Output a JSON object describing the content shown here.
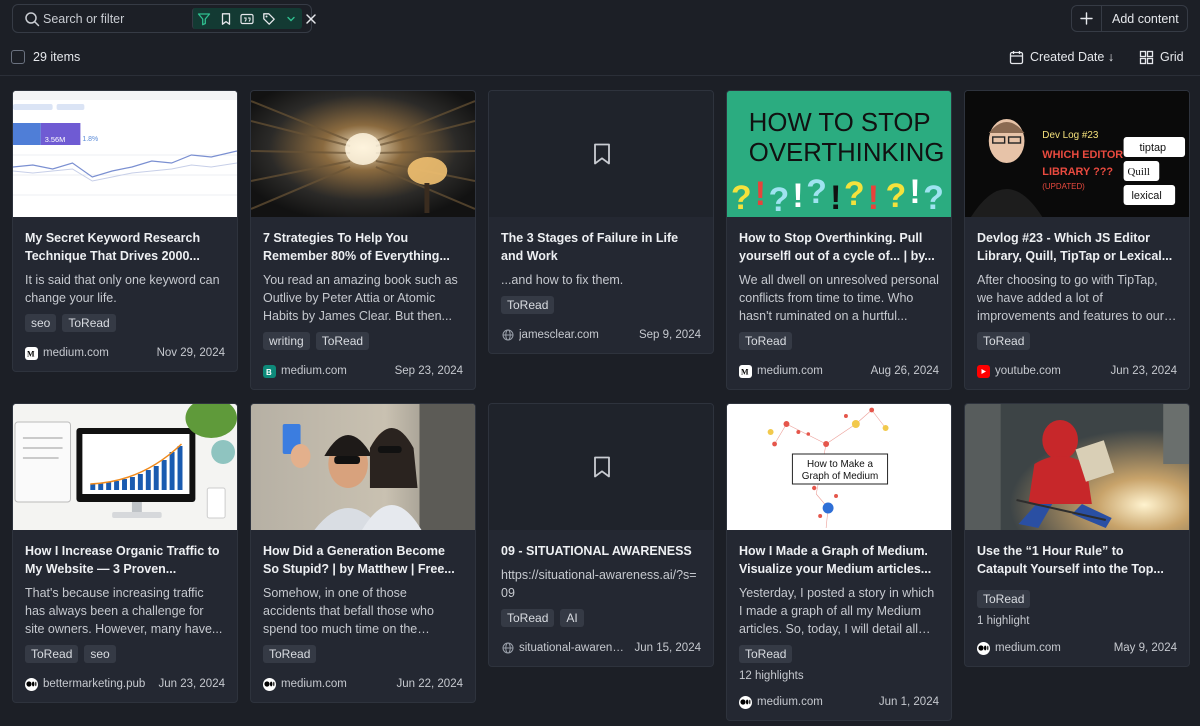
{
  "search": {
    "placeholder": "Search or filter"
  },
  "toolbar": {
    "add_label": "Add content",
    "items_count": "29 items",
    "sort_label": "Created Date ↓",
    "view_label": "Grid"
  },
  "colors": {
    "accent": "#2fbf8f",
    "background": "#1c1f26",
    "card": "#242832",
    "tag": "#353a45"
  },
  "cards": [
    {
      "title": "My Secret Keyword Research Technique That Drives 2000...",
      "desc": "It is said that only one keyword can change your life.",
      "tags": [
        "seo",
        "ToRead"
      ],
      "domain": "medium.com",
      "date": "Nov 29, 2024",
      "thumb": "analytics-chart",
      "dashboard_value": "3.56M",
      "dashboard_pct": "1.8%",
      "favicon": "medium-m-icon"
    },
    {
      "title": "7 Strategies To Help You Remember 80% of Everything...",
      "desc": "You read an amazing book such as Outlive by Peter Attia or Atomic Habits by James Clear. But then...",
      "tags": [
        "writing",
        "ToRead"
      ],
      "domain": "medium.com",
      "date": "Sep 23, 2024",
      "thumb": "library-tunnel",
      "favicon": "medium-b-icon"
    },
    {
      "title": "The 3 Stages of Failure in Life and Work",
      "desc": "...and how to fix them.",
      "tags": [
        "ToRead"
      ],
      "domain": "jamesclear.com",
      "date": "Sep 9, 2024",
      "thumb": "bookmark-placeholder",
      "favicon": "globe-icon"
    },
    {
      "title": "How to Stop Overthinking. Pull yourselfl out of a cycle of... | by...",
      "desc": "We all dwell on unresolved personal conflicts from time to time. Who hasn't ruminated on a hurtful...",
      "tags": [
        "ToRead"
      ],
      "domain": "medium.com",
      "date": "Aug 26, 2024",
      "thumb": "overthinking",
      "thumb_text_1": "HOW TO STOP",
      "thumb_text_2": "OVERTHINKING",
      "favicon": "medium-m-icon"
    },
    {
      "title": "Devlog #23 - Which JS Editor Library, Quill, TipTap or Lexical...",
      "desc": "After choosing to go with TipTap, we have added a lot of improvements and features to our implementation...",
      "tags": [
        "ToRead"
      ],
      "domain": "youtube.com",
      "date": "Jun 23, 2024",
      "thumb": "devlog",
      "thumb_text_1": "Dev Log #23",
      "thumb_text_2": "WHICH EDITOR",
      "thumb_text_3": "LIBRARY ???",
      "thumb_text_4": "(UPDATED)",
      "thumb_text_5": "tiptap",
      "thumb_text_6": "Quill",
      "thumb_text_7": "lexical",
      "favicon": "youtube-icon"
    },
    {
      "title": "How I Increase Organic Traffic to My Website — 3 Proven...",
      "desc": "That's because increasing traffic has always been a challenge for site owners. However, many have...",
      "tags": [
        "ToRead",
        "seo"
      ],
      "domain": "bettermarketing.pub",
      "date": "Jun 23, 2024",
      "thumb": "desk-monitor",
      "favicon": "medium-dots-icon"
    },
    {
      "title": "How Did a Generation Become So Stupid? | by Matthew | Free...",
      "desc": "Somehow, in one of those accidents that befall those who spend too much time on the Internet without...",
      "tags": [
        "ToRead"
      ],
      "domain": "medium.com",
      "date": "Jun 22, 2024",
      "thumb": "selfie",
      "favicon": "medium-dots-icon"
    },
    {
      "title": "09 - SITUATIONAL AWARENESS",
      "desc": "https://situational-awareness.ai/?s=09",
      "tags": [
        "ToRead",
        "AI"
      ],
      "domain": "situational-awarene...",
      "date": "Jun 15, 2024",
      "thumb": "bookmark-placeholder",
      "favicon": "globe-icon"
    },
    {
      "title": "How I Made a Graph of Medium. Visualize your Medium articles...",
      "desc": "Yesterday, I posted a story in which I made a graph of all my Medium articles. So, today, I will detail all th...",
      "tags": [
        "ToRead"
      ],
      "highlights": "12 highlights",
      "domain": "medium.com",
      "date": "Jun 1, 2024",
      "thumb": "graph",
      "thumb_text_1": "How to Make a",
      "thumb_text_2": "Graph of Medium",
      "favicon": "medium-dots-icon"
    },
    {
      "title": "Use the “1 Hour Rule” to Catapult Yourself into the Top...",
      "desc": "",
      "tags": [
        "ToRead"
      ],
      "highlights": "1 highlight",
      "domain": "medium.com",
      "date": "May 9, 2024",
      "thumb": "spiderman",
      "favicon": "medium-dots-icon"
    }
  ]
}
